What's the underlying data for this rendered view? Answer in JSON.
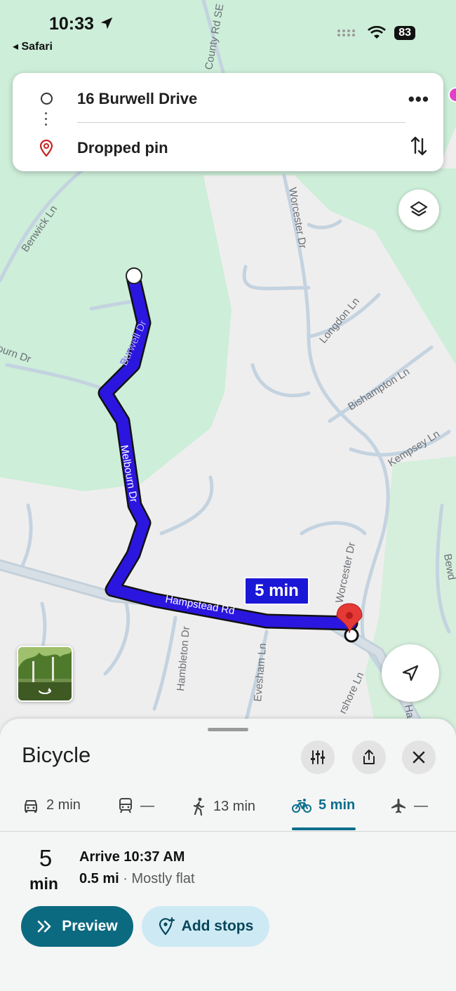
{
  "status": {
    "time": "10:33",
    "back_app": "Safari",
    "battery": "83"
  },
  "route": {
    "origin": "16 Burwell Drive",
    "destination": "Dropped pin"
  },
  "map": {
    "streets": {
      "county_rd": "County Rd SE",
      "benwick": "Benwick Ln",
      "melbourn_left": "ourn Dr",
      "burwell": "Burwell Dr",
      "melbourn": "Melbourn Dr",
      "worcester_top": "Worcester Dr",
      "longdon": "Longdon Ln",
      "bishampton": "Bishampton Ln",
      "kempsey": "Kempsey Ln",
      "worcester_bottom": "Worcester Dr",
      "hampstead": "Hampstead Rd",
      "hambleton": "Hambleton Dr",
      "evesham": "Evesham Ln",
      "shore": "rshore Ln",
      "bewd": "Bewd",
      "ha": "Ha"
    },
    "route_time_bubble": "5 min"
  },
  "sheet": {
    "title": "Bicycle",
    "modes": [
      {
        "icon": "car-icon",
        "label": "2 min"
      },
      {
        "icon": "transit-icon",
        "label": "—"
      },
      {
        "icon": "walk-icon",
        "label": "13 min"
      },
      {
        "icon": "bicycle-icon",
        "label": "5 min",
        "active": true
      },
      {
        "icon": "flight-icon",
        "label": "—"
      }
    ],
    "eta_value": "5",
    "eta_unit": "min",
    "arrive": "Arrive 10:37 AM",
    "distance": "0.5 mi",
    "terrain": " · Mostly flat",
    "preview_label": "Preview",
    "add_stops_label": "Add stops"
  },
  "colors": {
    "route": "#2b16e0",
    "accent": "#0b6a80",
    "park": "#cdeed9"
  }
}
